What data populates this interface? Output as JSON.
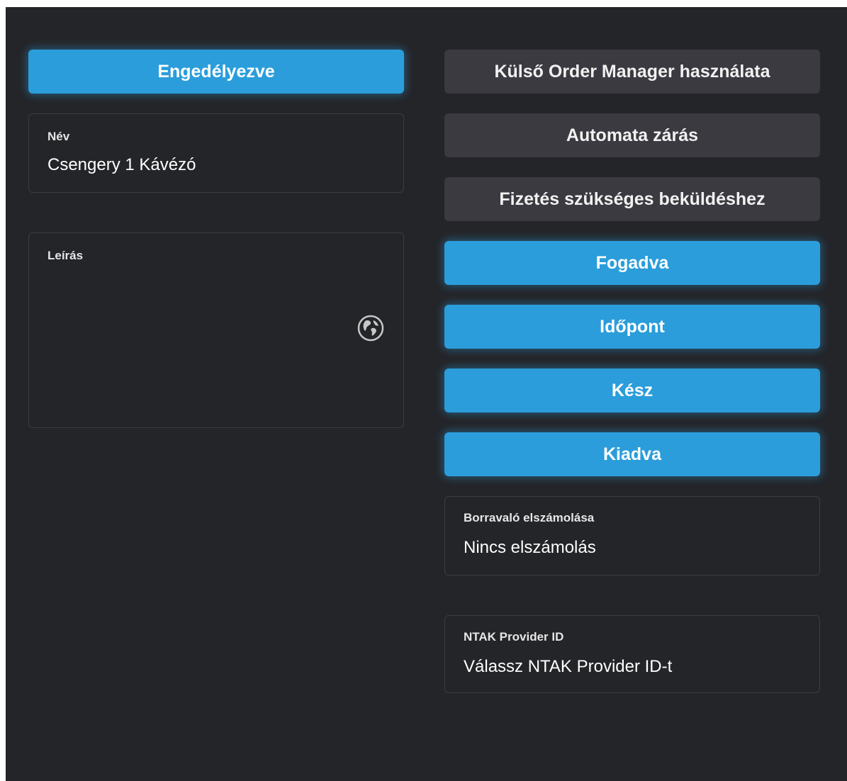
{
  "left": {
    "enabled_button": {
      "label": "Engedélyezve",
      "state": "on"
    },
    "name_field": {
      "label": "Név",
      "value": "Csengery 1 Kávézó"
    },
    "description_field": {
      "label": "Leírás",
      "value": "",
      "icon": "globe-icon"
    }
  },
  "right": {
    "toggles": [
      {
        "label": "Külső Order Manager használata",
        "state": "off"
      },
      {
        "label": "Automata zárás",
        "state": "off"
      },
      {
        "label": "Fizetés szükséges beküldéshez",
        "state": "off"
      },
      {
        "label": "Fogadva",
        "state": "on"
      },
      {
        "label": "Időpont",
        "state": "on"
      },
      {
        "label": "Kész",
        "state": "on"
      },
      {
        "label": "Kiadva",
        "state": "on"
      }
    ],
    "tip_field": {
      "label": "Borravaló elszámolása",
      "value": "Nincs elszámolás"
    },
    "ntak_field": {
      "label": "NTAK Provider ID",
      "value": "Válassz NTAK Provider ID-t"
    }
  },
  "colors": {
    "background": "#242529",
    "accent": "#2b9ddb",
    "toggle_off": "#3a3a40",
    "field_border": "#3b3c42"
  }
}
